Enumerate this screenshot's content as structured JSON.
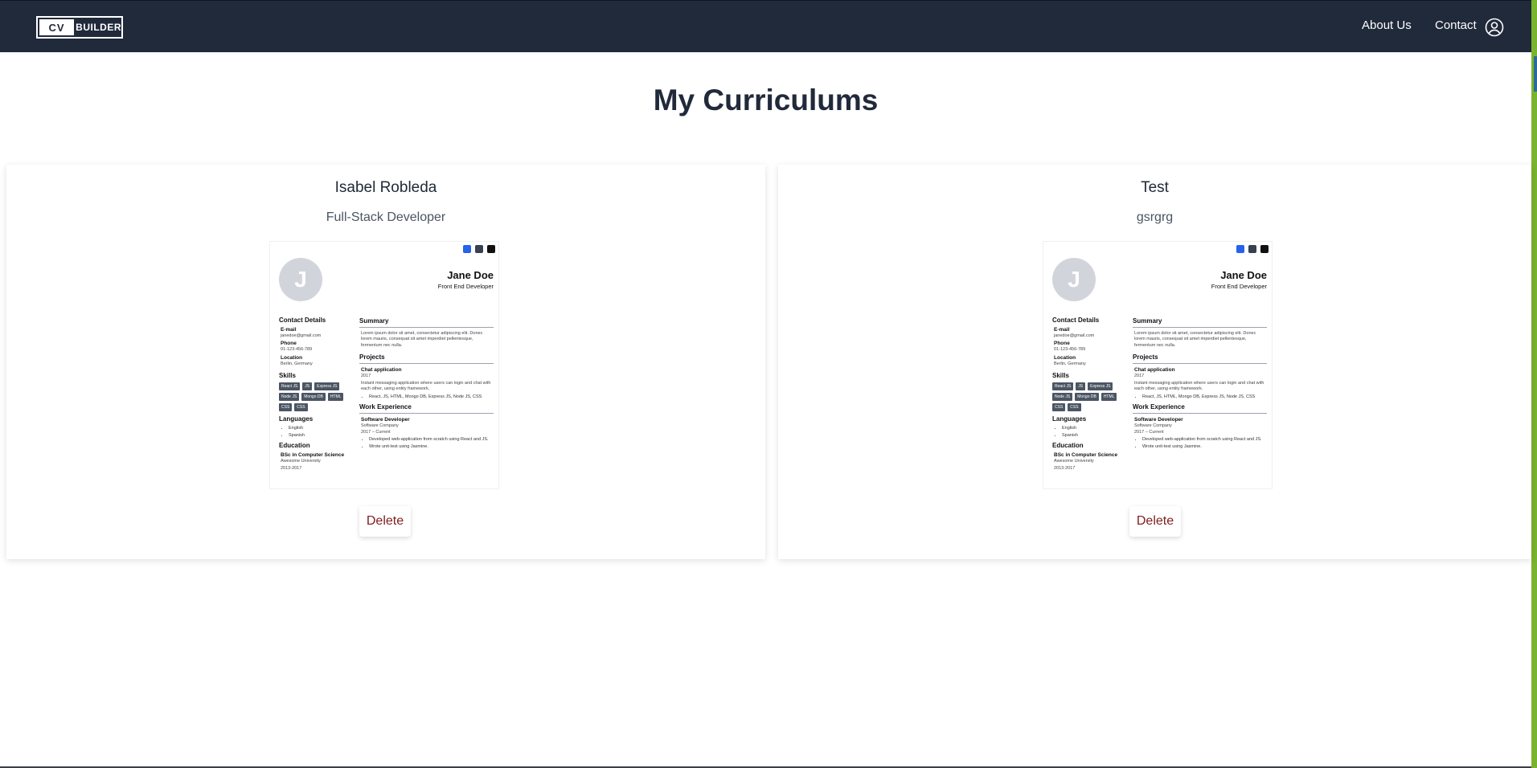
{
  "header": {
    "logo_cv": "CV",
    "logo_builder": "BUILDER",
    "nav": {
      "about": "About Us",
      "contact": "Contact"
    }
  },
  "page": {
    "title": "My Curriculums"
  },
  "cards": [
    {
      "name": "Isabel Robleda",
      "title": "Full-Stack Developer",
      "delete_label": "Delete"
    },
    {
      "name": "Test",
      "title": "gsrgrg",
      "delete_label": "Delete"
    }
  ],
  "preview": {
    "avatar_letter": "J",
    "name": "Jane Doe",
    "role": "Front End Developer",
    "contact_heading": "Contact Details",
    "email_label": "E-mail",
    "email": "janedoe@gmail.com",
    "phone_label": "Phone",
    "phone": "01-123-456-789",
    "location_label": "Location",
    "location": "Berlin, Germany",
    "skills_heading": "Skills",
    "skills": [
      "React JS",
      "JS",
      "Express JS",
      "Node JS",
      "Mongo DB",
      "HTML",
      "CSS",
      "CSS"
    ],
    "languages_heading": "Languages",
    "languages": [
      "English",
      "Spanish"
    ],
    "education_heading": "Education",
    "degree": "BSc in Computer Science",
    "university": "Awesome University",
    "edu_years": "2013-2017",
    "summary_heading": "Summary",
    "summary": "Lorem ipsum dolor sit amet, consectetur adipiscing elit. Donec lorem mauris, consequat sit amet imperdiet pellentesque, fermentum nec nulla.",
    "projects_heading": "Projects",
    "project_name": "Chat application",
    "project_year": "2017",
    "project_desc": "Instant messaging application where users can login and chat with each other, using entity framework.",
    "project_tech": "React, JS, HTML, Mongo DB, Express JS, Node JS, CSS",
    "work_heading": "Work Experience",
    "job_title": "Software Developer",
    "company": "Software Company",
    "job_years": "2017 – Current",
    "job_bullets": [
      "Developed web-application from scratch using React and JS.",
      "Wrote unit-test using Jasmine."
    ]
  },
  "colors": {
    "navbar": "#212a3b",
    "delete_text": "#7f1d1d",
    "accent_strip": "#7ab32e"
  }
}
